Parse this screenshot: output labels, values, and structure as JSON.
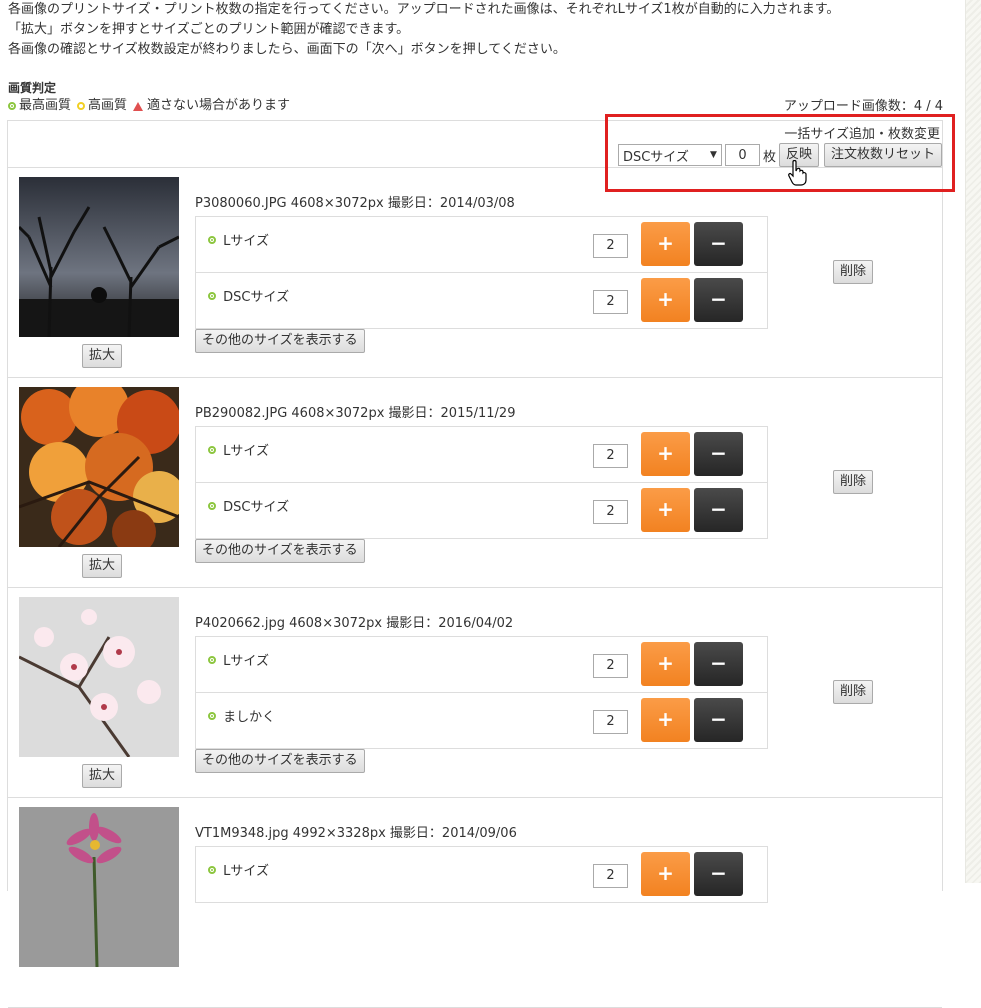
{
  "intro": {
    "line1": "各画像のプリントサイズ・プリント枚数の指定を行ってください。アップロードされた画像は、それぞれLサイズ1枚が自動的に入力されます。",
    "line2": "「拡大」ボタンを押すとサイズごとのプリント範囲が確認できます。",
    "line3": "各画像の確認とサイズ枚数設定が終わりましたら、画面下の「次へ」ボタンを押してください。"
  },
  "quality": {
    "title": "画質判定",
    "best": "最高画質",
    "high": "高画質",
    "warn": "適さない場合があります",
    "upload_count": "アップロード画像数：4 / 4"
  },
  "bulk": {
    "title": "一括サイズ追加・枚数変更",
    "select_value": "DSCサイズ",
    "qty": "0",
    "unit": "枚",
    "apply": "反映",
    "reset": "注文枚数リセット"
  },
  "common": {
    "zoom": "拡大",
    "other_sizes": "その他のサイズを表示する",
    "delete": "削除",
    "plus": "+",
    "minus": "−"
  },
  "images": [
    {
      "meta": "P3080060.JPG 4608×3072px 撮影日：2014/03/08",
      "sizes": [
        {
          "label": "Lサイズ",
          "qty": "2"
        },
        {
          "label": "DSCサイズ",
          "qty": "2"
        }
      ]
    },
    {
      "meta": "PB290082.JPG 4608×3072px 撮影日：2015/11/29",
      "sizes": [
        {
          "label": "Lサイズ",
          "qty": "2"
        },
        {
          "label": "DSCサイズ",
          "qty": "2"
        }
      ]
    },
    {
      "meta": "P4020662.jpg 4608×3072px 撮影日：2016/04/02",
      "sizes": [
        {
          "label": "Lサイズ",
          "qty": "2"
        },
        {
          "label": "ましかく",
          "qty": "2"
        }
      ]
    },
    {
      "meta": "VT1M9348.jpg 4992×3328px 撮影日：2014/09/06",
      "sizes": [
        {
          "label": "Lサイズ",
          "qty": "2"
        }
      ]
    }
  ],
  "colors": {
    "accent_orange": "#f28221",
    "dark_button": "#2f2f2f",
    "highlight": "#e02020",
    "best_quality": "#8cc63f",
    "high_quality": "#f2d024"
  }
}
